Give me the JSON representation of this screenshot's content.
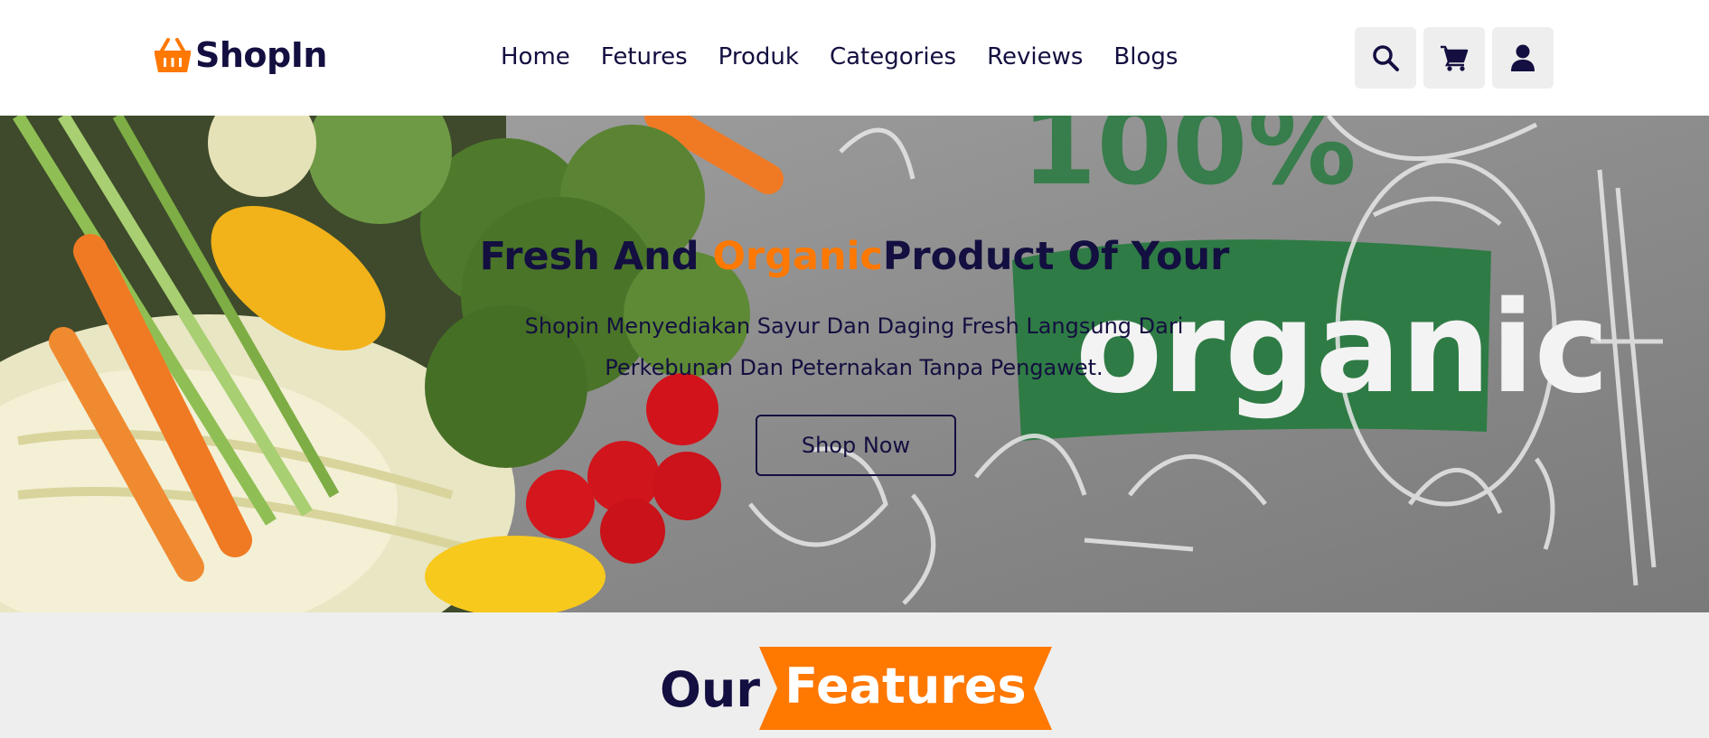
{
  "brand": {
    "name": "ShopIn",
    "icon": "basket-icon",
    "accent": "#ff7800",
    "primary": "#130f40"
  },
  "nav": {
    "items": [
      {
        "label": "Home"
      },
      {
        "label": "Fetures"
      },
      {
        "label": "Produk"
      },
      {
        "label": "Categories"
      },
      {
        "label": "Reviews"
      },
      {
        "label": "Blogs"
      }
    ]
  },
  "header_icons": [
    "search-icon",
    "cart-icon",
    "user-icon"
  ],
  "hero": {
    "title_part1": "Fresh And ",
    "title_accent": "Organic",
    "title_part2": "Product Of Your",
    "description": "Shopin Menyediakan Sayur Dan Daging Fresh Langsung Dari Perkebunan Dan Peternakan Tanpa Pengawet.",
    "button_label": "Shop Now",
    "banner_text": "organic",
    "banner_badge": "100%"
  },
  "features": {
    "heading_plain": "Our",
    "heading_highlight": "Features"
  }
}
